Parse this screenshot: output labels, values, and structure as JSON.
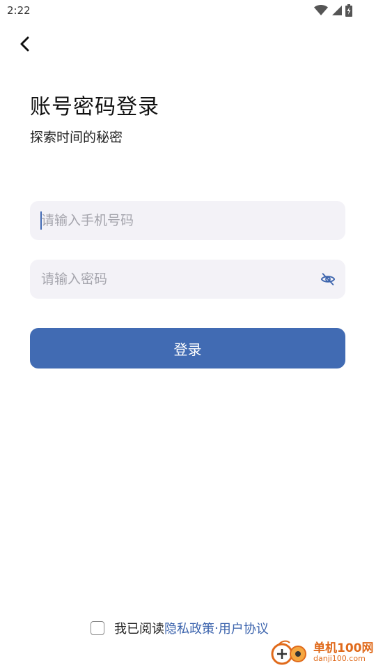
{
  "status_bar": {
    "time": "2:22",
    "icons": [
      "wifi-icon",
      "signal-icon",
      "battery-charging-icon"
    ]
  },
  "header": {
    "back_icon": "chevron-left-icon"
  },
  "title": {
    "main": "账号密码登录",
    "subtitle": "探索时间的秘密"
  },
  "form": {
    "phone": {
      "value": "",
      "placeholder": "请输入手机号码"
    },
    "password": {
      "value": "",
      "placeholder": "请输入密码",
      "toggle_icon": "eye-off-icon"
    },
    "login_label": "登录"
  },
  "agreement": {
    "checked": false,
    "prefix": "我已阅读",
    "privacy_link": "隐私政策",
    "separator": "·",
    "terms_link": "用户协议"
  },
  "watermark": {
    "name": "单机100网",
    "domain": "danji100.com"
  },
  "colors": {
    "accent": "#416bb3",
    "link": "#3c64ad",
    "input_bg": "#f3f2f7",
    "placeholder": "#a5a5ad",
    "watermark": "#e06a1b"
  }
}
